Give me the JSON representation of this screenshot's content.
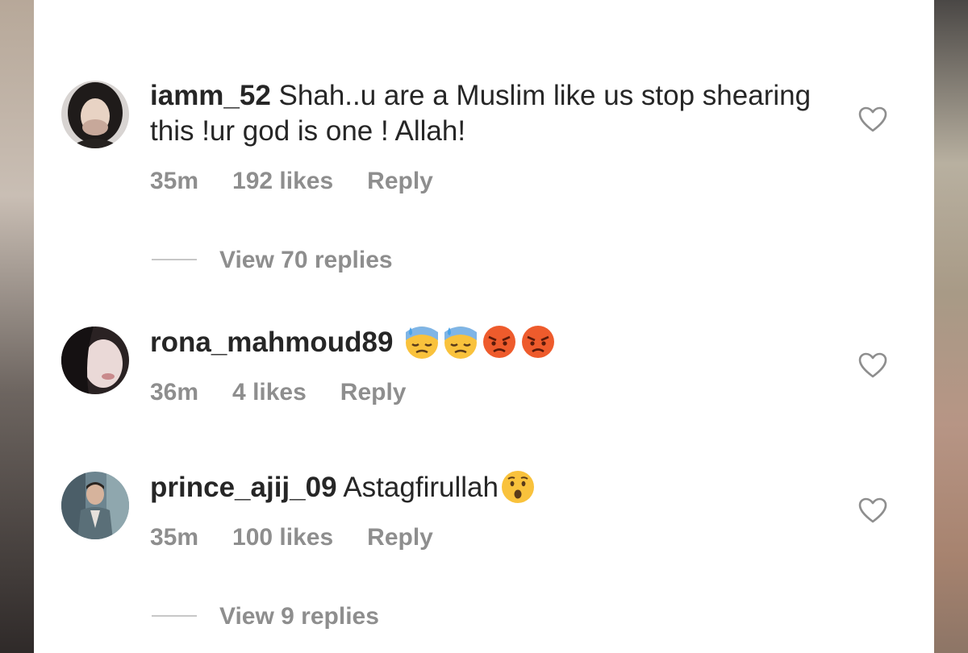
{
  "comments": [
    {
      "username": "iamm_52",
      "text": " Shah..u are a Muslim like us stop shearing this !ur god is one ! Allah!",
      "time": "35m",
      "likes": "192 likes",
      "reply_label": "Reply",
      "view_replies": "View 70 replies",
      "emojis": []
    },
    {
      "username": "rona_mahmoud89",
      "text": "",
      "time": "36m",
      "likes": "4 likes",
      "reply_label": "Reply",
      "view_replies": "",
      "emojis": [
        "downcast-face-with-sweat-emoji",
        "downcast-face-with-sweat-emoji",
        "pouting-face-emoji",
        "pouting-face-emoji"
      ]
    },
    {
      "username": "prince_ajij_09",
      "text": " Astagfirullah",
      "time": "35m",
      "likes": "100 likes",
      "reply_label": "Reply",
      "view_replies": "View 9 replies",
      "emojis": [
        "hushed-face-emoji"
      ]
    }
  ],
  "colors": {
    "text": "#262626",
    "meta": "#8e8e8e",
    "background": "#ffffff",
    "emoji_yellow": "#f9c23c",
    "emoji_red": "#ee5b2c"
  }
}
